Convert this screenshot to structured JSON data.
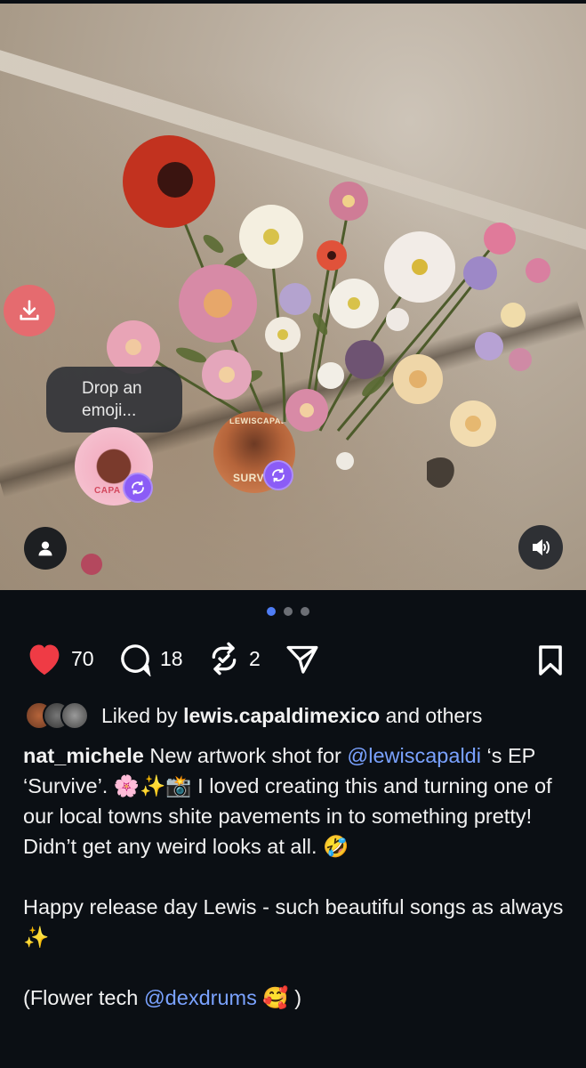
{
  "photo": {
    "emoji_prompt": "Drop an emoji...",
    "sticker_a_text": "CAPA",
    "sticker_b_text": "SURVIV",
    "sticker_b_top": "LEWISCAPALDI"
  },
  "carousel": {
    "total": 3,
    "active": 1
  },
  "actions": {
    "likes": "70",
    "comments": "18",
    "reposts": "2"
  },
  "liked_by": {
    "prefix": "Liked by",
    "user": "lewis.capaldimexico",
    "suffix": "and others"
  },
  "caption": {
    "username": "nat_michele",
    "text_1": " New artwork shot for ",
    "mention_1": "@lewiscapaldi",
    "text_2": " ‘s EP ‘Survive’. 🌸✨📸 I loved creating this and turning one of our local towns shite pavements in to something pretty! Didn’t get any weird looks at all. 🤣\n\nHappy release day Lewis - such beautiful songs as always ✨\n\n(Flower tech ",
    "mention_2": "@dexdrums",
    "text_3": " 🥰 )"
  },
  "colors": {
    "background": "#0b0f14",
    "like": "#ef3b45",
    "mention": "#7aa2ff",
    "active_dot": "#4f7df5",
    "repost_badge": "#8b5cf6",
    "download": "#e56b6f"
  },
  "icons": [
    "download-icon",
    "person-icon",
    "speaker-icon",
    "heart-icon",
    "comment-icon",
    "repost-icon",
    "share-icon",
    "bookmark-icon"
  ]
}
